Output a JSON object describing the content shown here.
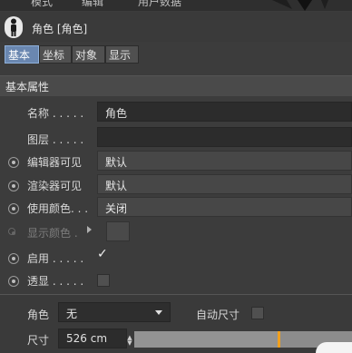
{
  "menubar": {
    "items": [
      "模式",
      "编辑",
      "用户数据"
    ]
  },
  "object": {
    "title": "角色 [角色]"
  },
  "tabs": [
    "基本",
    "坐标",
    "对象",
    "显示"
  ],
  "section": {
    "title": "基本属性"
  },
  "fields": {
    "name_label": "名称 . . . . .",
    "name_value": "角色",
    "layer_label": "图层 . . . . .",
    "editor_visible_label": "编辑器可见",
    "editor_visible_value": "默认",
    "render_visible_label": "渲染器可见",
    "render_visible_value": "默认",
    "use_color_label": "使用颜色. . .",
    "use_color_value": "关闭",
    "display_color_label": "显示颜色 .",
    "enabled_label": "启用 . . . . .",
    "enabled_mark": "✓",
    "xray_label": "透显 . . . . ."
  },
  "lower": {
    "role_label": "角色",
    "role_value": "无",
    "auto_size_label": "自动尺寸",
    "size_label": "尺寸",
    "size_value": "526 cm",
    "size_slider_fraction": 0.66
  },
  "colors": {
    "tab_active": "#6a87b0",
    "slider_thumb": "#f0a020"
  }
}
